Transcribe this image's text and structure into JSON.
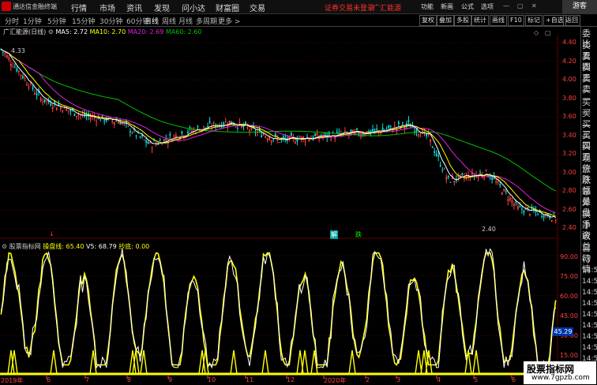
{
  "app": {
    "title": "通达信金融终端"
  },
  "menu": {
    "items": [
      "行情",
      "市场",
      "资讯",
      "发现",
      "问小达",
      "财富圈",
      "交易"
    ],
    "warning": "证券交易未登录",
    "broker": "广汇能源",
    "right_items": [
      "功能",
      "新画",
      "公式",
      "选项"
    ],
    "guest": "游客"
  },
  "toolbar": {
    "periods": [
      "分时",
      "1分钟",
      "5分钟",
      "15分钟",
      "30分钟",
      "60分钟",
      "日线",
      "周线",
      "月线",
      "多周期",
      "更多 >"
    ],
    "active_period": "日线",
    "buttons": [
      "复权",
      "叠加",
      "多股",
      "统计",
      "画线",
      "F10",
      "标记",
      "+自选",
      "返回"
    ]
  },
  "main_chart": {
    "stock_label": "广汇能源(日线)",
    "ma5_label": "MA5: 2.72",
    "ma10_label": "MA10: 2.70",
    "ma20_label": "MA20: 2.69",
    "ma60_label": "MA60: 2.60",
    "high_mark": "4.33",
    "low_mark": "2.40",
    "yticks": [
      "4.40",
      "4.20",
      "4.00",
      "3.80",
      "3.60",
      "3.40",
      "3.20",
      "3.00",
      "2.80",
      "2.60",
      "2.40"
    ],
    "mark_jie": "解",
    "mark_die": "跌"
  },
  "indicator": {
    "name": "股票指标网",
    "title": "操盘线: 65.40",
    "v5": "V5: 68.79",
    "chaodi": "抄底: 0.00",
    "yticks": [
      "90.00",
      "75.00",
      "60.00",
      "45.00",
      "30.00",
      "15.00"
    ],
    "current_value": "45.29"
  },
  "x_axis": {
    "labels": [
      "2019年",
      "6",
      "7",
      "8",
      "9",
      "10",
      "11",
      "12",
      "2020年",
      "2",
      "3",
      "4",
      "5",
      "6"
    ]
  },
  "right_panel": {
    "labels": [
      "委比",
      "卖五",
      "卖四",
      "卖三",
      "卖二",
      "卖一",
      "买一",
      "买二",
      "买三",
      "买四",
      "买五",
      "现价",
      "涨跌",
      "涨幅",
      "总量",
      "外盘",
      "换手",
      "净资",
      "收益",
      "自动",
      "行情"
    ],
    "times": [
      "14:5",
      "14:5",
      "14:5",
      "14:5",
      "14:5",
      "14:5",
      "14:5",
      "14:5",
      "14:5",
      "14:5"
    ]
  },
  "watermark": {
    "line1": "股票指标网",
    "line2": "www.7gpzb.com"
  },
  "colors": {
    "up": "#ff4040",
    "down": "#00e5e5",
    "ma5": "#ffffff",
    "ma10": "#ffff00",
    "ma20": "#e020e0",
    "ma60": "#00c000",
    "indicator": "#ffff00"
  }
}
